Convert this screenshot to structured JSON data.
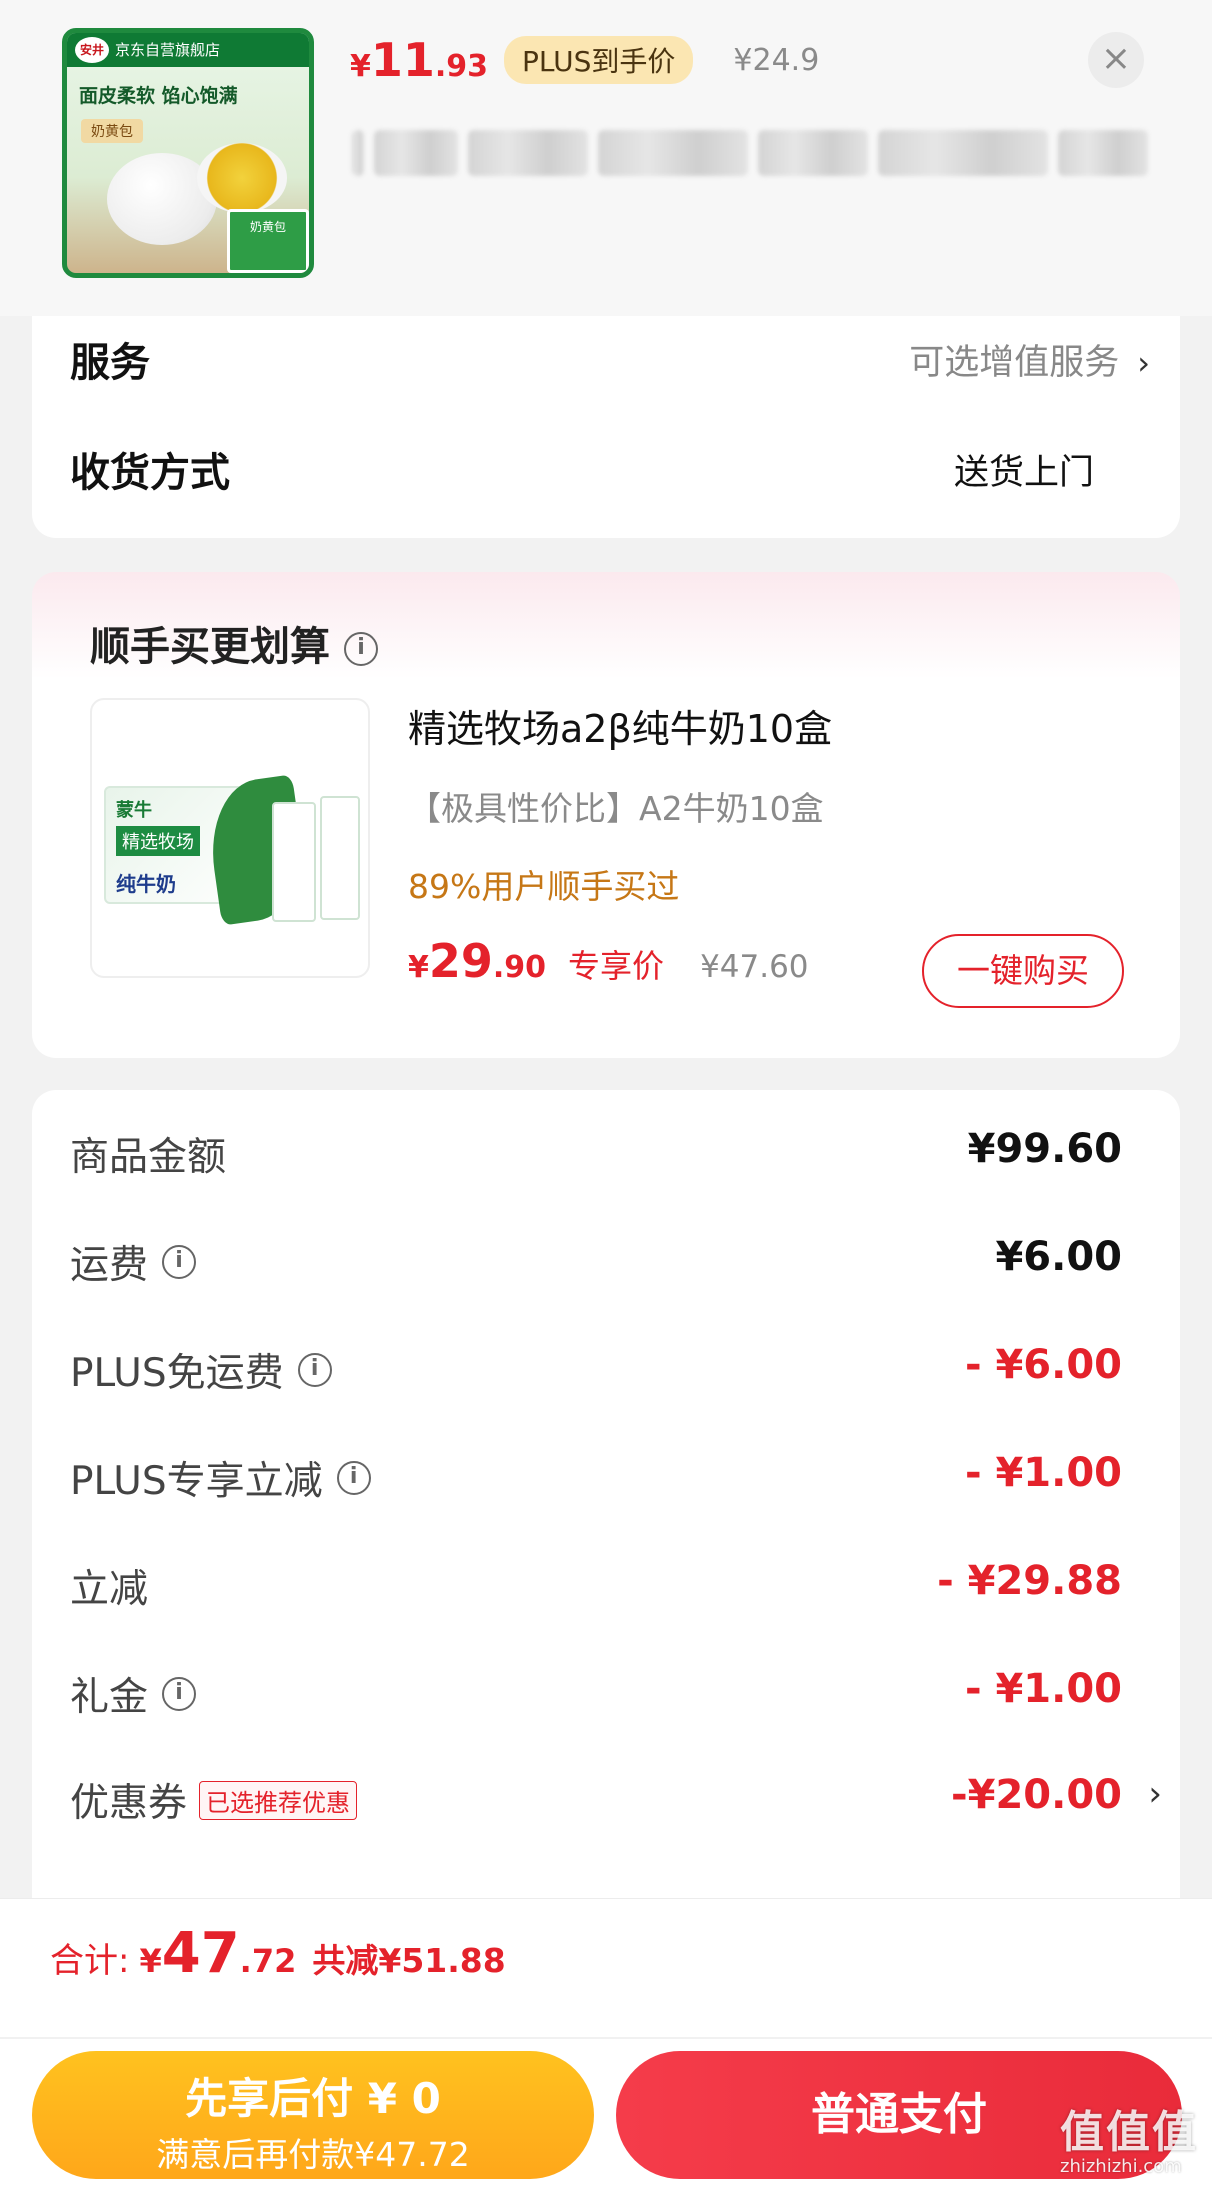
{
  "product_header": {
    "thumb": {
      "brand_bar": "京东自营旗舰店",
      "logo_text": "安井",
      "slogan": "面皮柔软 馅心饱满",
      "tag": "奶黄包",
      "pack_label": "奶黄包"
    },
    "price_symbol": "¥",
    "price_int": "11",
    "price_dec": ".93",
    "plus_badge": "PLUS到手价",
    "original_price": "¥24.9",
    "close_icon": "×"
  },
  "service": {
    "service_label": "服务",
    "service_value": "可选增值服务",
    "delivery_label": "收货方式",
    "delivery_value": "送货上门",
    "chevron": "›"
  },
  "upsell": {
    "title": "顺手买更划算",
    "info_icon": "i",
    "image": {
      "brand": "蒙牛",
      "line1": "精选牧场",
      "line2": "纯牛奶"
    },
    "name": "精选牧场a2β纯牛奶10盒",
    "desc": "【极具性价比】A2牛奶10盒",
    "social": "89%用户顺手买过",
    "price_symbol": "¥",
    "price_int": "29",
    "price_dec": ".90",
    "exclusive": "专享价",
    "original": "¥47.60",
    "buy_button": "一键购买"
  },
  "breakdown": {
    "rows": [
      {
        "label": "商品金额",
        "value": "¥99.60",
        "info": false,
        "red": false
      },
      {
        "label": "运费",
        "value": "¥6.00",
        "info": true,
        "red": false
      },
      {
        "label": "PLUS免运费",
        "value": "- ¥6.00",
        "info": true,
        "red": true
      },
      {
        "label": "PLUS专享立减",
        "value": "- ¥1.00",
        "info": true,
        "red": true
      },
      {
        "label": "立减",
        "value": "- ¥29.88",
        "info": false,
        "red": true
      },
      {
        "label": "礼金",
        "value": "- ¥1.00",
        "info": true,
        "red": true
      },
      {
        "label": "优惠券",
        "value": "-¥20.00",
        "info": false,
        "red": true
      }
    ],
    "coupon_tag": "已选推荐优惠",
    "chevron": "›"
  },
  "footer": {
    "total_label": "合计:",
    "total_symbol": "¥",
    "total_int": "47",
    "total_dec": ".72",
    "total_saved": "共减¥51.88",
    "paylater_title": "先享后付 ¥ 0",
    "paylater_sub": "满意后再付款¥47.72",
    "normal_pay": "普通支付"
  },
  "watermark": {
    "text": "值值值",
    "url": "zhizhizhi.com"
  },
  "colors": {
    "accent_red": "#e4222b",
    "plus_gold": "#fbe6b2",
    "paylater_yellow": "#ffb51d",
    "social_orange": "#c67716"
  }
}
